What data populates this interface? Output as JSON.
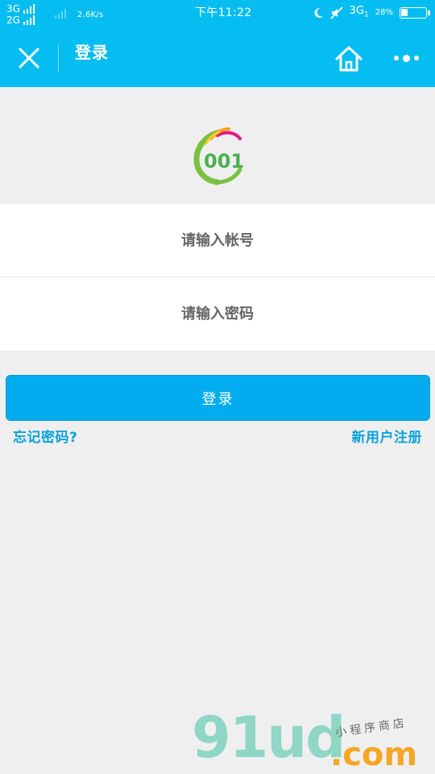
{
  "status_bar": {
    "net1": "3G",
    "net2": "2G",
    "speed": "2.6K/s",
    "time": "下午11:22",
    "net3": "3G",
    "net3_sub": "1",
    "battery_percent_text": "28%",
    "battery_level": 0.28
  },
  "nav": {
    "title": "登录"
  },
  "form": {
    "account_placeholder": "请输入帐号",
    "account_value": "",
    "password_placeholder": "请输入密码",
    "password_value": ""
  },
  "actions": {
    "login_label": "登录",
    "forgot_label": "忘记密码?",
    "register_label": "新用户注册"
  },
  "logo": {
    "text": "001"
  },
  "watermark": {
    "main": "91ud",
    "domain": ".com",
    "tag": "小程序商店"
  },
  "colors": {
    "header": "#06bdf2",
    "button": "#03acee",
    "link": "#0aa3dc",
    "background": "#efefef"
  }
}
